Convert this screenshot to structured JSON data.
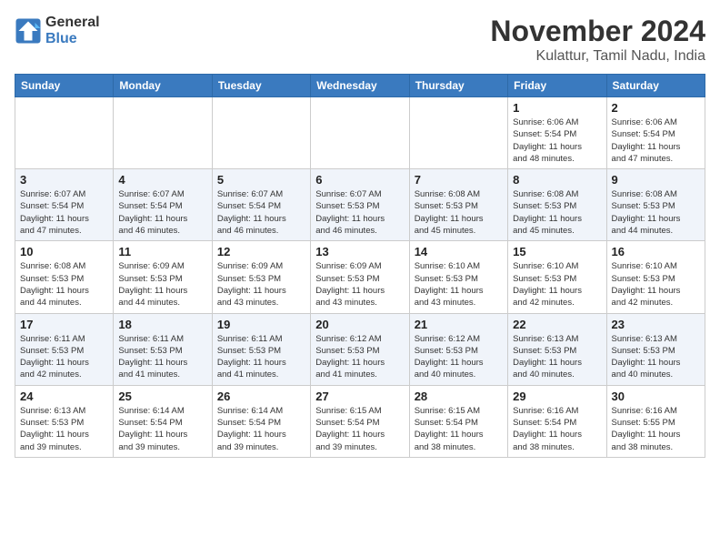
{
  "logo": {
    "general": "General",
    "blue": "Blue"
  },
  "header": {
    "month": "November 2024",
    "location": "Kulattur, Tamil Nadu, India"
  },
  "weekdays": [
    "Sunday",
    "Monday",
    "Tuesday",
    "Wednesday",
    "Thursday",
    "Friday",
    "Saturday"
  ],
  "weeks": [
    [
      {
        "day": "",
        "info": ""
      },
      {
        "day": "",
        "info": ""
      },
      {
        "day": "",
        "info": ""
      },
      {
        "day": "",
        "info": ""
      },
      {
        "day": "",
        "info": ""
      },
      {
        "day": "1",
        "info": "Sunrise: 6:06 AM\nSunset: 5:54 PM\nDaylight: 11 hours\nand 48 minutes."
      },
      {
        "day": "2",
        "info": "Sunrise: 6:06 AM\nSunset: 5:54 PM\nDaylight: 11 hours\nand 47 minutes."
      }
    ],
    [
      {
        "day": "3",
        "info": "Sunrise: 6:07 AM\nSunset: 5:54 PM\nDaylight: 11 hours\nand 47 minutes."
      },
      {
        "day": "4",
        "info": "Sunrise: 6:07 AM\nSunset: 5:54 PM\nDaylight: 11 hours\nand 46 minutes."
      },
      {
        "day": "5",
        "info": "Sunrise: 6:07 AM\nSunset: 5:54 PM\nDaylight: 11 hours\nand 46 minutes."
      },
      {
        "day": "6",
        "info": "Sunrise: 6:07 AM\nSunset: 5:53 PM\nDaylight: 11 hours\nand 46 minutes."
      },
      {
        "day": "7",
        "info": "Sunrise: 6:08 AM\nSunset: 5:53 PM\nDaylight: 11 hours\nand 45 minutes."
      },
      {
        "day": "8",
        "info": "Sunrise: 6:08 AM\nSunset: 5:53 PM\nDaylight: 11 hours\nand 45 minutes."
      },
      {
        "day": "9",
        "info": "Sunrise: 6:08 AM\nSunset: 5:53 PM\nDaylight: 11 hours\nand 44 minutes."
      }
    ],
    [
      {
        "day": "10",
        "info": "Sunrise: 6:08 AM\nSunset: 5:53 PM\nDaylight: 11 hours\nand 44 minutes."
      },
      {
        "day": "11",
        "info": "Sunrise: 6:09 AM\nSunset: 5:53 PM\nDaylight: 11 hours\nand 44 minutes."
      },
      {
        "day": "12",
        "info": "Sunrise: 6:09 AM\nSunset: 5:53 PM\nDaylight: 11 hours\nand 43 minutes."
      },
      {
        "day": "13",
        "info": "Sunrise: 6:09 AM\nSunset: 5:53 PM\nDaylight: 11 hours\nand 43 minutes."
      },
      {
        "day": "14",
        "info": "Sunrise: 6:10 AM\nSunset: 5:53 PM\nDaylight: 11 hours\nand 43 minutes."
      },
      {
        "day": "15",
        "info": "Sunrise: 6:10 AM\nSunset: 5:53 PM\nDaylight: 11 hours\nand 42 minutes."
      },
      {
        "day": "16",
        "info": "Sunrise: 6:10 AM\nSunset: 5:53 PM\nDaylight: 11 hours\nand 42 minutes."
      }
    ],
    [
      {
        "day": "17",
        "info": "Sunrise: 6:11 AM\nSunset: 5:53 PM\nDaylight: 11 hours\nand 42 minutes."
      },
      {
        "day": "18",
        "info": "Sunrise: 6:11 AM\nSunset: 5:53 PM\nDaylight: 11 hours\nand 41 minutes."
      },
      {
        "day": "19",
        "info": "Sunrise: 6:11 AM\nSunset: 5:53 PM\nDaylight: 11 hours\nand 41 minutes."
      },
      {
        "day": "20",
        "info": "Sunrise: 6:12 AM\nSunset: 5:53 PM\nDaylight: 11 hours\nand 41 minutes."
      },
      {
        "day": "21",
        "info": "Sunrise: 6:12 AM\nSunset: 5:53 PM\nDaylight: 11 hours\nand 40 minutes."
      },
      {
        "day": "22",
        "info": "Sunrise: 6:13 AM\nSunset: 5:53 PM\nDaylight: 11 hours\nand 40 minutes."
      },
      {
        "day": "23",
        "info": "Sunrise: 6:13 AM\nSunset: 5:53 PM\nDaylight: 11 hours\nand 40 minutes."
      }
    ],
    [
      {
        "day": "24",
        "info": "Sunrise: 6:13 AM\nSunset: 5:53 PM\nDaylight: 11 hours\nand 39 minutes."
      },
      {
        "day": "25",
        "info": "Sunrise: 6:14 AM\nSunset: 5:54 PM\nDaylight: 11 hours\nand 39 minutes."
      },
      {
        "day": "26",
        "info": "Sunrise: 6:14 AM\nSunset: 5:54 PM\nDaylight: 11 hours\nand 39 minutes."
      },
      {
        "day": "27",
        "info": "Sunrise: 6:15 AM\nSunset: 5:54 PM\nDaylight: 11 hours\nand 39 minutes."
      },
      {
        "day": "28",
        "info": "Sunrise: 6:15 AM\nSunset: 5:54 PM\nDaylight: 11 hours\nand 38 minutes."
      },
      {
        "day": "29",
        "info": "Sunrise: 6:16 AM\nSunset: 5:54 PM\nDaylight: 11 hours\nand 38 minutes."
      },
      {
        "day": "30",
        "info": "Sunrise: 6:16 AM\nSunset: 5:55 PM\nDaylight: 11 hours\nand 38 minutes."
      }
    ]
  ]
}
